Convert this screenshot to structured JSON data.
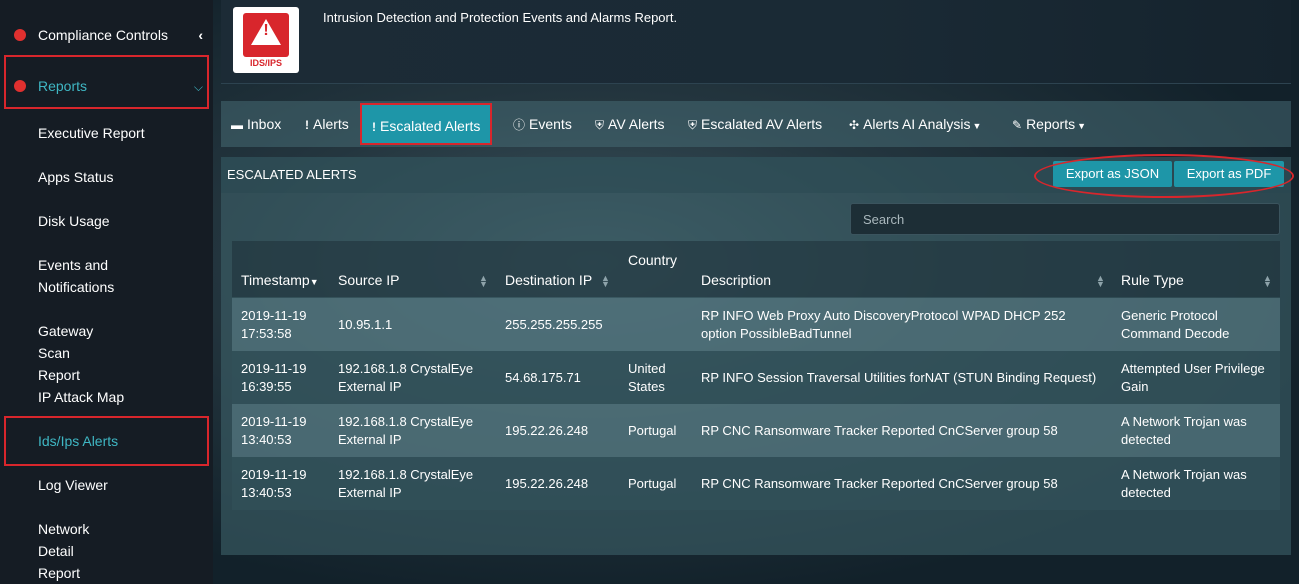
{
  "sidebar": {
    "items": [
      {
        "label": "Compliance Controls"
      },
      {
        "label": "Reports"
      },
      {
        "label": "Executive Report"
      },
      {
        "label": "Apps Status"
      },
      {
        "label": "Disk Usage"
      },
      {
        "label": "Events and Notifications"
      },
      {
        "label": "Gateway Scan Report"
      },
      {
        "label": "IP Attack Map"
      },
      {
        "label": "Ids/Ips Alerts"
      },
      {
        "label": "Log Viewer"
      },
      {
        "label": "Network Detail Report"
      }
    ]
  },
  "header": {
    "logo_label": "IDS/IPS",
    "logo_icon": "warning-triangle-icon",
    "description": "Intrusion Detection and Protection Events and Alarms Report."
  },
  "tabs": [
    {
      "label": "Inbox",
      "icon": "inbox-icon"
    },
    {
      "label": "Alerts",
      "icon": "exclamation-icon"
    },
    {
      "label": "Escalated Alerts",
      "icon": "exclamation-icon"
    },
    {
      "label": "Events",
      "icon": "info-circle-icon"
    },
    {
      "label": "AV Alerts",
      "icon": "shield-icon"
    },
    {
      "label": "Escalated AV Alerts",
      "icon": "shield-icon"
    },
    {
      "label": "Alerts AI Analysis",
      "icon": "ai-icon"
    },
    {
      "label": "Reports",
      "icon": "pencil-icon"
    }
  ],
  "panel": {
    "title": "ESCALATED ALERTS",
    "export_json": "Export as JSON",
    "export_pdf": "Export as PDF",
    "search_placeholder": "Search"
  },
  "table": {
    "headers": {
      "timestamp": "Timestamp",
      "source_ip": "Source IP",
      "destination_ip": "Destination IP",
      "country": "Country",
      "description": "Description",
      "rule_type": "Rule Type"
    },
    "rows": [
      {
        "date": "2019-11-19",
        "time": "17:53:58",
        "source": "10.95.1.1",
        "source2": "",
        "dest": "255.255.255.255",
        "country": "",
        "country2": "",
        "desc": "RP INFO Web Proxy Auto DiscoveryProtocol WPAD DHCP 252",
        "desc2": "option PossibleBadTunnel",
        "rule": "Generic Protocol",
        "rule2": "Command Decode"
      },
      {
        "date": "2019-11-19",
        "time": "16:39:55",
        "source": "192.168.1.8 CrystalEye",
        "source2": "External IP",
        "dest": "54.68.175.71",
        "country": "United",
        "country2": "States",
        "desc": "RP INFO Session Traversal Utilities forNAT (STUN Binding Request)",
        "desc2": "",
        "rule": "Attempted User Privilege",
        "rule2": "Gain"
      },
      {
        "date": "2019-11-19",
        "time": "13:40:53",
        "source": "192.168.1.8 CrystalEye",
        "source2": "External IP",
        "dest": "195.22.26.248",
        "country": "Portugal",
        "country2": "",
        "desc": "RP CNC Ransomware Tracker Reported CnCServer group 58",
        "desc2": "",
        "rule": "A Network Trojan was",
        "rule2": "detected"
      },
      {
        "date": "2019-11-19",
        "time": "13:40:53",
        "source": "192.168.1.8 CrystalEye",
        "source2": "External IP",
        "dest": "195.22.26.248",
        "country": "Portugal",
        "country2": "",
        "desc": "RP CNC Ransomware Tracker Reported CnCServer group 58",
        "desc2": "",
        "rule": "A Network Trojan was",
        "rule2": "detected"
      }
    ]
  }
}
